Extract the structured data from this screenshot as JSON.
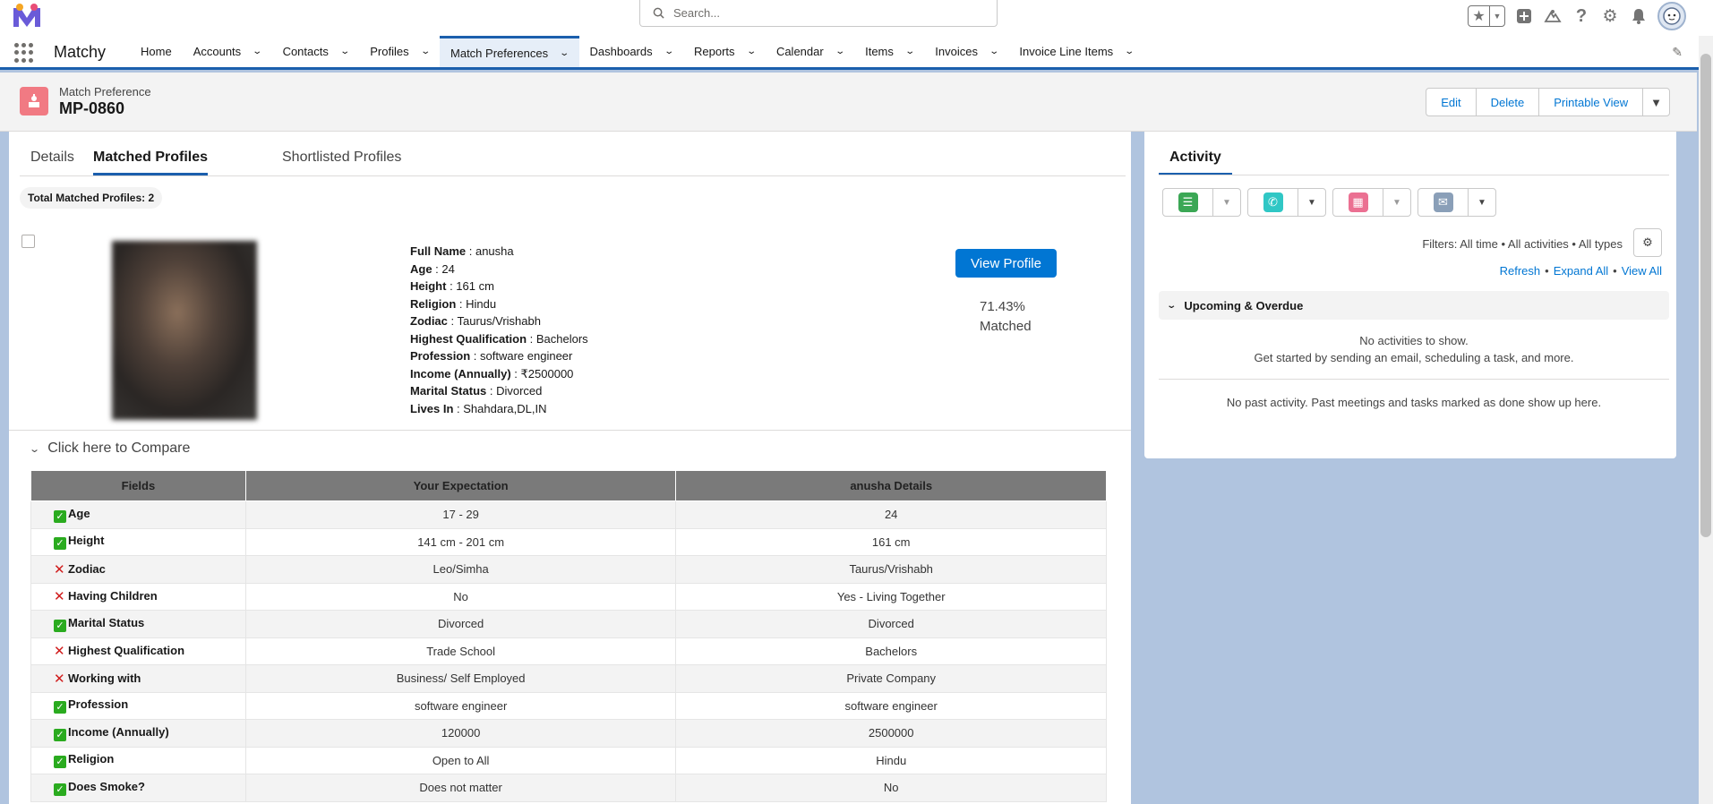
{
  "header": {
    "search_placeholder": "Search..."
  },
  "nav": {
    "app_name": "Matchy",
    "items": [
      {
        "label": "Home",
        "dropdown": false
      },
      {
        "label": "Accounts",
        "dropdown": true
      },
      {
        "label": "Contacts",
        "dropdown": true
      },
      {
        "label": "Profiles",
        "dropdown": true
      },
      {
        "label": "Match Preferences",
        "dropdown": true,
        "active": true
      },
      {
        "label": "Dashboards",
        "dropdown": true
      },
      {
        "label": "Reports",
        "dropdown": true
      },
      {
        "label": "Calendar",
        "dropdown": true
      },
      {
        "label": "Items",
        "dropdown": true
      },
      {
        "label": "Invoices",
        "dropdown": true
      },
      {
        "label": "Invoice Line Items",
        "dropdown": true
      }
    ]
  },
  "record": {
    "type": "Match Preference",
    "name": "MP-0860",
    "actions": {
      "edit": "Edit",
      "delete": "Delete",
      "printable": "Printable View"
    }
  },
  "tabs": {
    "details": "Details",
    "matched": "Matched Profiles",
    "shortlisted": "Shortlisted Profiles"
  },
  "matched": {
    "total": "Total Matched Profiles: 2",
    "profile": {
      "fields": [
        {
          "label": "Full Name",
          "value": "anusha"
        },
        {
          "label": "Age",
          "value": "24"
        },
        {
          "label": "Height",
          "value": "161 cm"
        },
        {
          "label": "Religion",
          "value": "Hindu"
        },
        {
          "label": "Zodiac",
          "value": "Taurus/Vrishabh"
        },
        {
          "label": "Highest Qualification",
          "value": "Bachelors"
        },
        {
          "label": "Profession",
          "value": "software engineer"
        },
        {
          "label": "Income (Annually)",
          "value": "₹2500000"
        },
        {
          "label": "Marital Status",
          "value": "Divorced"
        },
        {
          "label": "Lives In",
          "value": "Shahdara,DL,IN"
        }
      ],
      "view_button": "View Profile",
      "match_percent": "71.43%",
      "match_label": "Matched"
    },
    "compare_toggle": "Click here to Compare",
    "table": {
      "headers": [
        "Fields",
        "Your Expectation",
        "anusha Details"
      ],
      "rows": [
        {
          "ok": true,
          "field": "Age",
          "expect": "17 - 29",
          "actual": "24"
        },
        {
          "ok": true,
          "field": "Height",
          "expect": "141 cm - 201 cm",
          "actual": "161 cm"
        },
        {
          "ok": false,
          "field": "Zodiac",
          "expect": "Leo/Simha",
          "actual": "Taurus/Vrishabh"
        },
        {
          "ok": false,
          "field": "Having Children",
          "expect": "No",
          "actual": "Yes - Living Together"
        },
        {
          "ok": true,
          "field": "Marital Status",
          "expect": "Divorced",
          "actual": "Divorced"
        },
        {
          "ok": false,
          "field": "Highest Qualification",
          "expect": "Trade School",
          "actual": "Bachelors"
        },
        {
          "ok": false,
          "field": "Working with",
          "expect": "Business/ Self Employed",
          "actual": "Private Company"
        },
        {
          "ok": true,
          "field": "Profession",
          "expect": "software engineer",
          "actual": "software engineer"
        },
        {
          "ok": true,
          "field": "Income (Annually)",
          "expect": "120000",
          "actual": "2500000"
        },
        {
          "ok": true,
          "field": "Religion",
          "expect": "Open to All",
          "actual": "Hindu"
        },
        {
          "ok": true,
          "field": "Does Smoke?",
          "expect": "Does not matter",
          "actual": "No"
        }
      ]
    }
  },
  "activity": {
    "tab": "Activity",
    "filters": "Filters: All time • All activities • All types",
    "links": {
      "refresh": "Refresh",
      "expand": "Expand All",
      "view": "View All"
    },
    "upcoming": "Upcoming & Overdue",
    "no_activities": "No activities to show.",
    "get_started": "Get started by sending an email, scheduling a task, and more.",
    "no_past": "No past activity. Past meetings and tasks marked as done show up here.",
    "colors": {
      "task": "#3ba755",
      "call": "#30c7c5",
      "event": "#eb7092",
      "email": "#8a9fb8"
    }
  }
}
